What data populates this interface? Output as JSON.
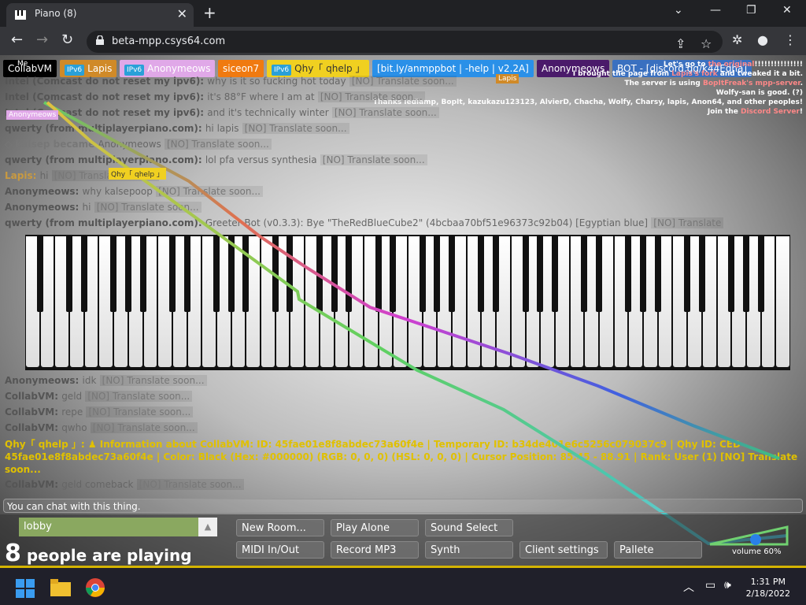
{
  "browser": {
    "tab_title": "Piano (8)",
    "tab_close": "✕",
    "new_tab": "+",
    "url": "beta-mpp.csys64.com",
    "controls": {
      "minimize": "⌄",
      "min": "—",
      "max": "❐",
      "close": "✕"
    }
  },
  "page": {
    "me_label": "Me",
    "users": [
      {
        "name": "CollabVM",
        "ipv6": false,
        "bg": "#000000",
        "color": "#ffffff"
      },
      {
        "name": "Lapis",
        "ipv6": true,
        "bg": "#d08a28",
        "color": "#ffffff"
      },
      {
        "name": "Anonymeows",
        "ipv6": true,
        "bg": "#e0a8e8",
        "color": "#ffffff"
      },
      {
        "name": "siceon7",
        "ipv6": false,
        "bg": "#f07a10",
        "color": "#ffffff"
      },
      {
        "name": "Qhy「 qhelp 」",
        "ipv6": true,
        "bg": "#f0d020",
        "color": "#333333"
      },
      {
        "name": "[bit.ly/anmppbot | -help | v2.2A]",
        "ipv6": false,
        "bg": "#2a90e8",
        "color": "#ffffff"
      },
      {
        "name": "Anonymeows",
        "ipv6": false,
        "bg": "#4a1a6a",
        "color": "#ffffff"
      },
      {
        "name": "BOT - [discord.gg/k44Eqha]",
        "ipv6": false,
        "bg": "#3a70c0",
        "color": "#ffffff"
      }
    ],
    "ipv6_label": "IPv6",
    "info_lines": [
      {
        "pre": "Let's go to ",
        "link": "the original",
        "post": "!!!!!!!!!!!!!!!"
      },
      {
        "pre": "I brought the page from ",
        "link": "Lapis's fork",
        "post": " and tweaked it a bit."
      },
      {
        "pre": "The server is using ",
        "link": "BopItFreak's mpp-server",
        "post": "."
      },
      {
        "pre": "Wolfy-san is good. (?)",
        "link": "",
        "post": ""
      },
      {
        "pre": "Thanks ledlamp, BopIt, kazukazu123123, AlvierD, Chacha, Wolfy, Charsy, lapis, Anon64, and other peoples!",
        "link": "",
        "post": ""
      },
      {
        "pre": "Join the ",
        "link": "Discord Server",
        "post": "!"
      }
    ],
    "chat": [
      {
        "name": "Intel (Comcast do not reset my ipv6):",
        "msg": "why is it so fucking hot today",
        "tag": "[NO] Translate soon...",
        "color": "#555555"
      },
      {
        "name": "Intel (Comcast do not reset my ipv6):",
        "msg": "it's 88°F where I am at",
        "tag": "[NO] Translate soon...",
        "color": "#555555"
      },
      {
        "name": "Intel (Comcast do not reset my ipv6):",
        "msg": "and it's technically winter",
        "tag": "[NO] Translate soon...",
        "color": "#555555"
      },
      {
        "name": "qwerty (from multiplayerpiano.com):",
        "msg": "hi lapis",
        "tag": "[NO] Translate soon...",
        "color": "#555555"
      },
      {
        "name": "◇ kalsep became",
        "msg": "Anonymeows",
        "tag": "[NO] Translate soon...",
        "color": "#777777"
      },
      {
        "name": "qwerty (from multiplayerpiano.com):",
        "msg": "lol pfa versus synthesia",
        "tag": "[NO] Translate soon...",
        "color": "#555555"
      },
      {
        "name": "Lapis:",
        "msg": "hi",
        "tag": "[NO] Translate soon...",
        "color": "#c99a40"
      },
      {
        "name": "Anonymeows:",
        "msg": "why kalsepoop",
        "tag": "[NO] Translate soon...",
        "color": "#555555"
      },
      {
        "name": "Anonymeows:",
        "msg": "hi",
        "tag": "[NO] Translate soon...",
        "color": "#555555"
      },
      {
        "name": "qwerty (from multiplayerpiano.com):",
        "msg": "Greeter Bot (v0.3.3): Bye \"TheRedBlueCube2\" (4bcbaa70bf51e96373c92b04) [Egyptian blue]",
        "tag": "[NO] Translate",
        "color": "#555555"
      },
      {
        "name": "Anonymeows:",
        "msg": "idk",
        "tag": "[NO] Translate soon...",
        "color": "#555555"
      },
      {
        "name": "CollabVM:",
        "msg": "geld",
        "tag": "[NO] Translate soon...",
        "color": "#555555"
      },
      {
        "name": "CollabVM:",
        "msg": "repe",
        "tag": "[NO] Translate soon...",
        "color": "#555555"
      },
      {
        "name": "CollabVM:",
        "msg": "qwho",
        "tag": "[NO] Translate soon...",
        "color": "#555555"
      }
    ],
    "qhy_line1": "Qhy「 qhelp 」:  ♟ Information about CollabVM: ID: 45fae01e8f8abdec73a60f4e | Temporary ID: b34de401e6c5256c079037c9 | Qhy ID: CED-",
    "qhy_line2": "45fae01e8f8abdec73a60f4e | Color: Black (Hex: #000000) (RGB: 0, 0, 0) (HSL: 0, 0, 0) | Cursor Position: 85.45 - 88.91 | Rank: User (1) [NO] Translate",
    "qhy_line3": "soon...",
    "last_chat": {
      "name": "CollabVM:",
      "msg": "geld comeback",
      "tag": "[NO] Translate soon..."
    },
    "chat_placeholder": "You can chat with this thing.",
    "room": "lobby",
    "players_count": "8",
    "players_text": "people are playing",
    "buttons": {
      "new_room": "New Room...",
      "play_alone": "Play Alone",
      "sound_select": "Sound Select",
      "midi": "MIDI In/Out",
      "record": "Record MP3",
      "synth": "Synth",
      "client_settings": "Client settings",
      "pallete": "Pallete"
    },
    "volume_label": "volume 60%",
    "volume_level": 0.6,
    "cursor_labels": {
      "anonymeows": "Anonymeows",
      "qhy": "Qhy「 qhelp 」",
      "lapis": "Lapis"
    }
  },
  "taskbar": {
    "time": "1:31 PM",
    "date": "2/18/2022"
  }
}
